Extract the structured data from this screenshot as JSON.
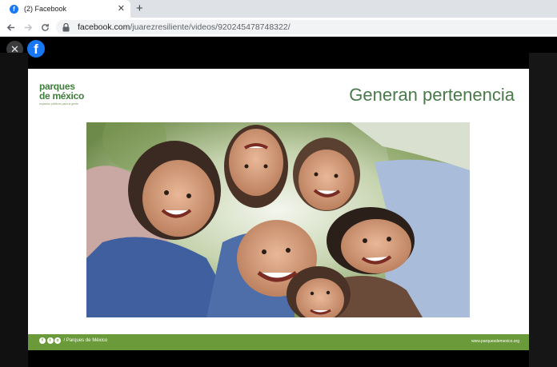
{
  "browser": {
    "tab_title": "(2) Facebook",
    "tab_close": "✕",
    "new_tab": "+",
    "favicon_letter": "f",
    "url_host": "facebook.com",
    "url_path": "/juarezresiliente/videos/920245478748322/"
  },
  "viewer": {
    "close": "✕",
    "logo_letter": "f"
  },
  "slide": {
    "logo_line1": "parques",
    "logo_line2": "de méxico",
    "logo_tagline": "espacios públicos para la gente",
    "title": "Generan pertenencia",
    "footer_label": "/ Parques de México",
    "footer_url": "www.parquesdemexico.org",
    "social_icons": [
      "facebook-icon",
      "twitter-icon",
      "instagram-icon"
    ],
    "social_glyphs": [
      "f",
      "t",
      "o"
    ]
  },
  "colors": {
    "brand_green": "#4a7a4a",
    "band_green": "#6b9a3b",
    "facebook_blue": "#1877f2"
  }
}
